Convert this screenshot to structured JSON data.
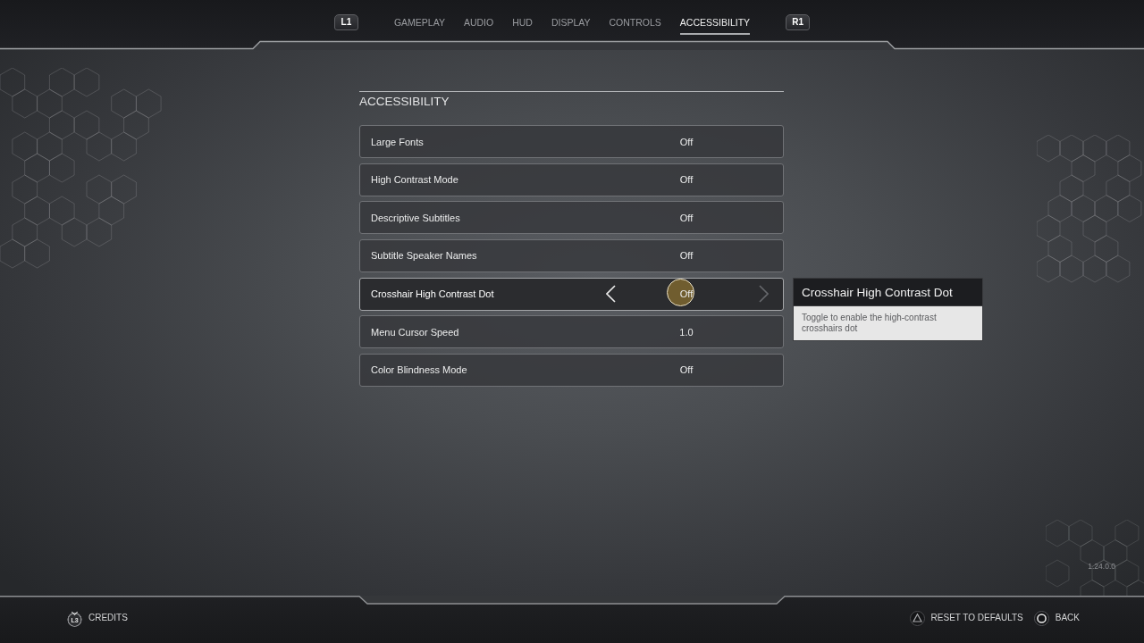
{
  "top_nav": {
    "prev_button": "L1",
    "tabs": [
      {
        "label": "GAMEPLAY",
        "selected": false
      },
      {
        "label": "AUDIO",
        "selected": false
      },
      {
        "label": "HUD",
        "selected": false
      },
      {
        "label": "DISPLAY",
        "selected": false
      },
      {
        "label": "CONTROLS",
        "selected": false
      },
      {
        "label": "ACCESSIBILITY",
        "selected": true
      }
    ],
    "next_button": "R1"
  },
  "settings": {
    "title": "ACCESSIBILITY",
    "rows": [
      {
        "label": "Large Fonts",
        "value": "Off",
        "selected": false
      },
      {
        "label": "High Contrast Mode",
        "value": "Off",
        "selected": false
      },
      {
        "label": "Descriptive Subtitles",
        "value": "Off",
        "selected": false
      },
      {
        "label": "Subtitle Speaker Names",
        "value": "Off",
        "selected": false
      },
      {
        "label": "Crosshair High Contrast Dot",
        "value": "Off",
        "selected": true
      },
      {
        "label": "Menu Cursor Speed",
        "value": "1.0",
        "selected": false
      },
      {
        "label": "Color Blindness Mode",
        "value": "Off",
        "selected": false
      }
    ]
  },
  "tooltip": {
    "title": "Crosshair High Contrast Dot",
    "description": "Toggle to enable the high-contrast crosshairs dot"
  },
  "version": "1.24.0.0",
  "footer": {
    "left": [
      {
        "kind": "stick",
        "key": "L3",
        "label": "CREDITS"
      }
    ],
    "right": [
      {
        "kind": "triangle",
        "label": "RESET TO DEFAULTS"
      },
      {
        "kind": "circle",
        "label": "BACK"
      }
    ]
  }
}
